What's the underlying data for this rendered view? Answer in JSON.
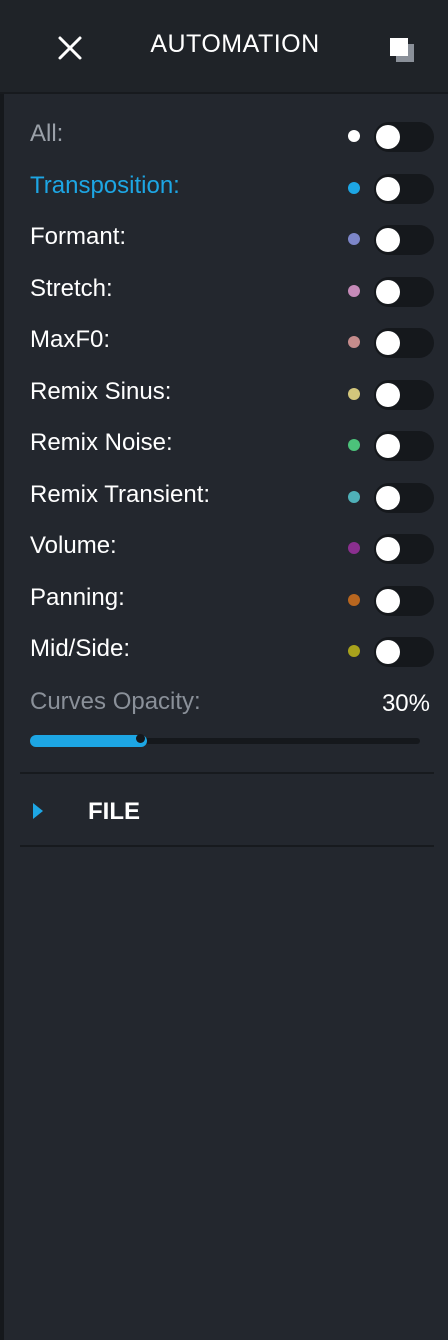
{
  "header": {
    "title": "AUTOMATION",
    "close_icon": "close-icon",
    "detach_icon": "detach-window-icon"
  },
  "rows": [
    {
      "label": "All:",
      "dot_color": "#ffffff",
      "state": "dim"
    },
    {
      "label": "Transposition:",
      "dot_color": "#1da6e4",
      "state": "active"
    },
    {
      "label": "Formant:",
      "dot_color": "#7d86c9",
      "state": "normal"
    },
    {
      "label": "Stretch:",
      "dot_color": "#c58ab8",
      "state": "normal"
    },
    {
      "label": "MaxF0:",
      "dot_color": "#c58c8c",
      "state": "normal"
    },
    {
      "label": "Remix Sinus:",
      "dot_color": "#d3c67c",
      "state": "normal"
    },
    {
      "label": "Remix Noise:",
      "dot_color": "#4cc27a",
      "state": "normal"
    },
    {
      "label": "Remix Transient:",
      "dot_color": "#4fb0b8",
      "state": "normal"
    },
    {
      "label": "Volume:",
      "dot_color": "#8a2f8f",
      "state": "normal"
    },
    {
      "label": "Panning:",
      "dot_color": "#b8661f",
      "state": "normal"
    },
    {
      "label": "Mid/Side:",
      "dot_color": "#a8a21c",
      "state": "normal"
    }
  ],
  "curves_opacity": {
    "label": "Curves Opacity:",
    "value_text": "30%",
    "value": 0.3
  },
  "file_section": {
    "label": "FILE",
    "icon": "chevron-right-icon",
    "accent": "#1da6e4"
  }
}
